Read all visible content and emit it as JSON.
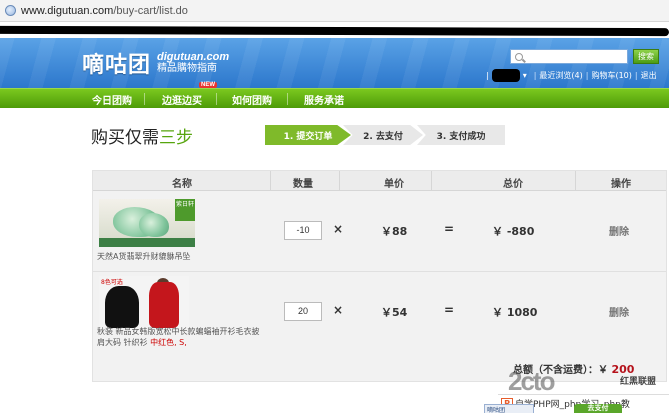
{
  "browser": {
    "url_host": "www.digutuan.com",
    "url_path": "/buy-cart/list.do"
  },
  "header": {
    "logo_cn": "嘀咕团",
    "logo_domain": "digutuan.com",
    "logo_slogan": "精品購物指南",
    "search_button": "搜索",
    "user_links": [
      "最近浏览(4)",
      "购物车(10)",
      "退出"
    ]
  },
  "nav": {
    "items": [
      "今日团购",
      "边逛边买",
      "如何团购",
      "服务承诺"
    ],
    "new_badge": "NEW"
  },
  "page": {
    "title_prefix": "购买仅需",
    "title_highlight": "三步"
  },
  "steps": [
    "1. 提交订单",
    "2. 去支付",
    "3. 支付成功"
  ],
  "table": {
    "headers": [
      "名称",
      "数量",
      "单价",
      "总价",
      "操作"
    ],
    "rows": [
      {
        "thumb_tag": "紫日轩",
        "name": "天然A货翡翠升财貔貅吊坠",
        "qty": "-10",
        "times": "×",
        "price": "￥88",
        "equals": "=",
        "total": "￥ -880",
        "action": "删除"
      },
      {
        "thumb_label": "8色可选",
        "name": "秋装 新品女韩版宽松中长款蝙蝠袖开衫毛衣披肩大码 针织衫",
        "name_suffix": "中红色, S,",
        "qty": "20",
        "times": "×",
        "price": "￥54",
        "equals": "=",
        "total": "￥ 1080",
        "action": "删除"
      }
    ],
    "sum_label": "总额（不含运费）：￥",
    "sum_value": "200"
  },
  "watermark": {
    "logo": "2cto",
    "brand": "红黑联盟",
    "strip": "自学PHP网_php学习_php教"
  },
  "bottom": {
    "tab": "嘀咕团",
    "checkout": "去支付"
  }
}
